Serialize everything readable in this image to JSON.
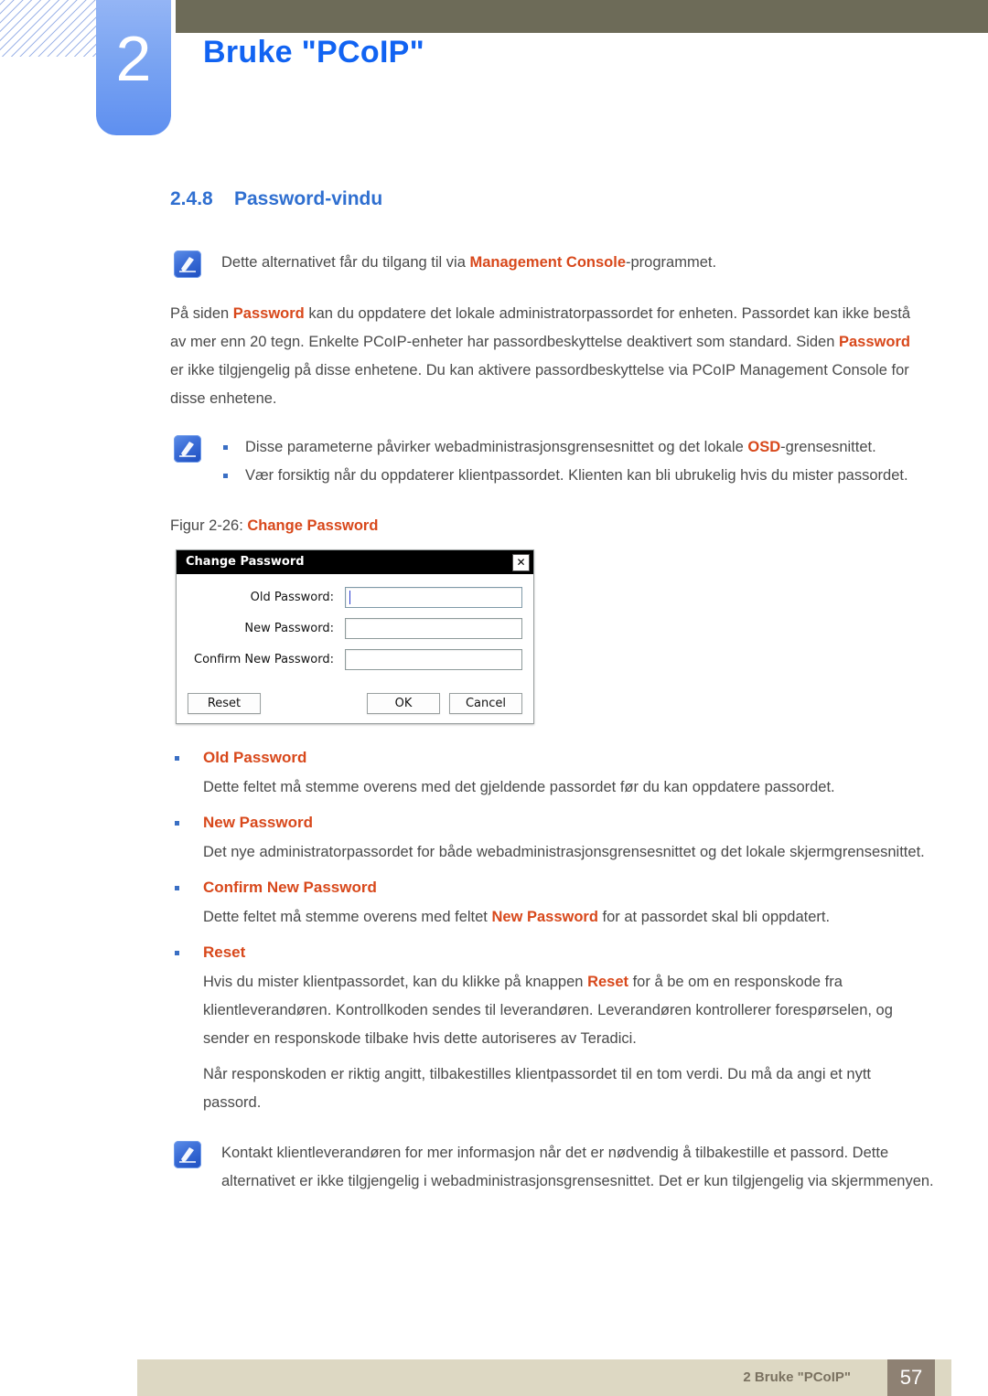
{
  "header": {
    "chapter_number": "2",
    "chapter_title": "Bruke \"PCoIP\"",
    "tab_color": "#7aa4f2",
    "bar_color": "#6d6b58",
    "title_color": "#1163f2"
  },
  "section": {
    "number": "2.4.8",
    "title": "Password-vindu",
    "title_color": "#2f6fd0"
  },
  "note_top": {
    "icon": "note-pen-icon",
    "text_before": "Dette alternativet får du tilgang til via ",
    "keyword": "Management Console",
    "text_after": "-programmet."
  },
  "intro": {
    "p1_a": "På siden ",
    "p1_kw1": "Password",
    "p1_b": " kan du oppdatere det lokale administratorpassordet for enheten. Passordet kan ikke bestå av mer enn 20 tegn. Enkelte PCoIP-enheter har passordbeskyttelse deaktivert som standard. Siden ",
    "p1_kw2": "Password",
    "p1_c": " er ikke tilgjengelig på disse enhetene. Du kan aktivere passordbeskyttelse via PCoIP Management Console for disse enhetene."
  },
  "note_bullets": {
    "icon": "note-pen-icon",
    "items": [
      {
        "text_before": "Disse parameterne påvirker webadministrasjonsgrensesnittet og det lokale ",
        "keyword": "OSD",
        "text_after": "-grensesnittet."
      },
      {
        "text_before": "Vær forsiktig når du oppdaterer klientpassordet. Klienten kan bli ubrukelig hvis du mister passordet.",
        "keyword": "",
        "text_after": ""
      }
    ]
  },
  "figure": {
    "caption_prefix": "Figur 2-26: ",
    "caption_name": "Change Password",
    "caption_color": "#d8481b"
  },
  "dialog": {
    "title": "Change Password",
    "close_label": "✕",
    "fields": [
      {
        "label": "Old Password:",
        "value": "",
        "focused": true
      },
      {
        "label": "New Password:",
        "value": "",
        "focused": false
      },
      {
        "label": "Confirm New Password:",
        "value": "",
        "focused": false
      }
    ],
    "buttons": {
      "reset": "Reset",
      "ok": "OK",
      "cancel": "Cancel"
    }
  },
  "terms": [
    {
      "term": "Old Password",
      "paragraphs": [
        {
          "a": "Dette feltet må stemme overens med det gjeldende passordet før du kan oppdatere passordet.",
          "kw": "",
          "b": ""
        }
      ]
    },
    {
      "term": "New Password",
      "paragraphs": [
        {
          "a": "Det nye administratorpassordet for både webadministrasjonsgrensesnittet og det lokale skjermgrensesnittet.",
          "kw": "",
          "b": ""
        }
      ]
    },
    {
      "term": "Confirm New Password",
      "paragraphs": [
        {
          "a": "Dette feltet må stemme overens med feltet ",
          "kw": "New Password",
          "b": " for at passordet skal bli oppdatert."
        }
      ]
    },
    {
      "term": "Reset",
      "paragraphs": [
        {
          "a": "Hvis du mister klientpassordet, kan du klikke på knappen ",
          "kw": "Reset",
          "b": " for å be om en responskode fra klientleverandøren. Kontrollkoden sendes til leverandøren. Leverandøren kontrollerer forespørselen, og sender en responskode tilbake hvis dette autoriseres av Teradici."
        },
        {
          "a": "Når responskoden er riktig angitt, tilbakestilles klientpassordet til en tom verdi. Du må da angi et nytt passord.",
          "kw": "",
          "b": ""
        }
      ]
    }
  ],
  "note_bottom": {
    "icon": "note-pen-icon",
    "text": "Kontakt klientleverandøren for mer informasjon når det er nødvendig å tilbakestille et passord. Dette alternativet er ikke tilgjengelig i webadministrasjonsgrensesnittet. Det er kun tilgjengelig via skjermmenyen."
  },
  "footer": {
    "text": "2 Bruke \"PCoIP\"",
    "page_number": "57",
    "bar_color": "#ddd8c3",
    "page_box_color": "#8e8173"
  }
}
